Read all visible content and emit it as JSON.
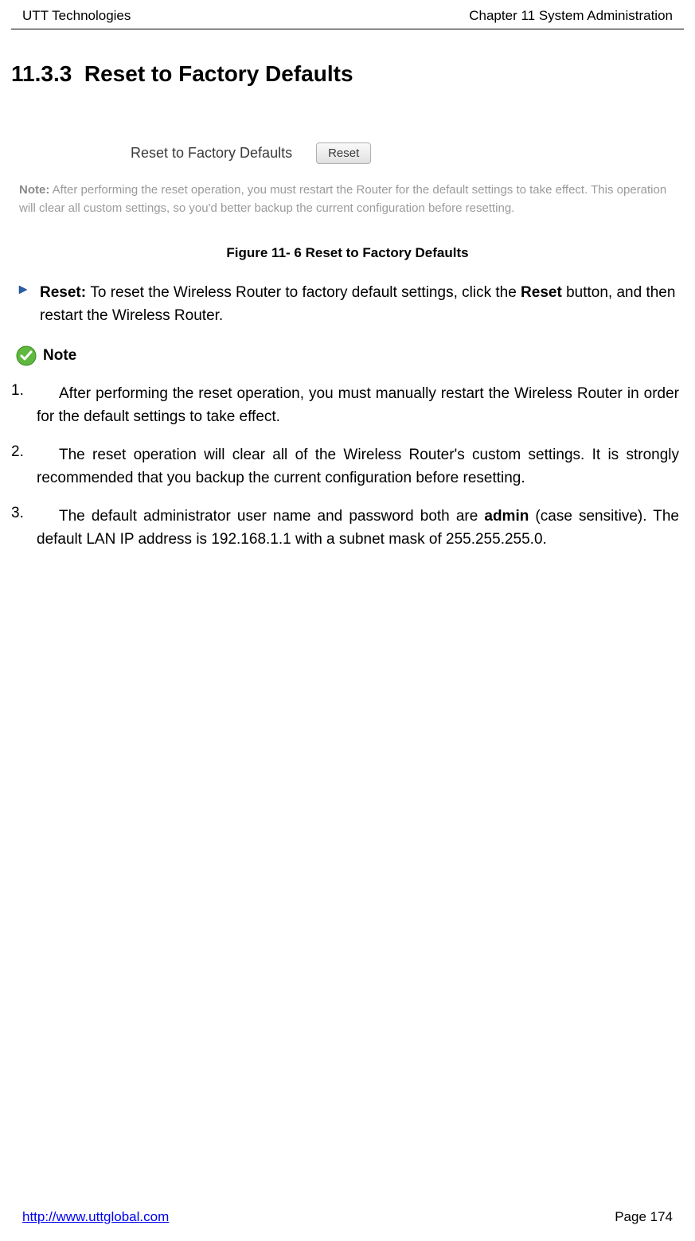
{
  "header": {
    "left": "UTT Technologies",
    "right": "Chapter 11 System Administration"
  },
  "section": {
    "number": "11.3.3",
    "title": "Reset to Factory Defaults"
  },
  "screenshot": {
    "label": "Reset to Factory Defaults",
    "button": "Reset",
    "note_bold": "Note:",
    "note_text": " After performing the reset operation, you must restart the Router for the default settings to take effect. This operation will clear all custom settings, so you'd better backup the current configuration before resetting."
  },
  "figure_caption": "Figure 11- 6 Reset to Factory Defaults",
  "bullet": {
    "bold1": "Reset: ",
    "t1": "To reset the Wireless Router to factory default settings, click the ",
    "bold2": "Reset",
    "t2": " button, and then restart the Wireless Router."
  },
  "note_label": "Note",
  "items": [
    {
      "num": "1.",
      "text": "After performing the reset operation, you must manually restart the Wireless Router in order for the default settings to take effect."
    },
    {
      "num": "2.",
      "text": "The reset operation will clear all of the Wireless Router's custom settings. It is strongly recommended that you backup the current configuration before resetting."
    },
    {
      "num": "3.",
      "t1": "The default administrator user name and password both are ",
      "bold": "admin",
      "t2": " (case sensitive). The default LAN IP address is 192.168.1.1 with a subnet mask of 255.255.255.0."
    }
  ],
  "footer": {
    "link": "http://www.uttglobal.com",
    "page": "Page 174"
  }
}
